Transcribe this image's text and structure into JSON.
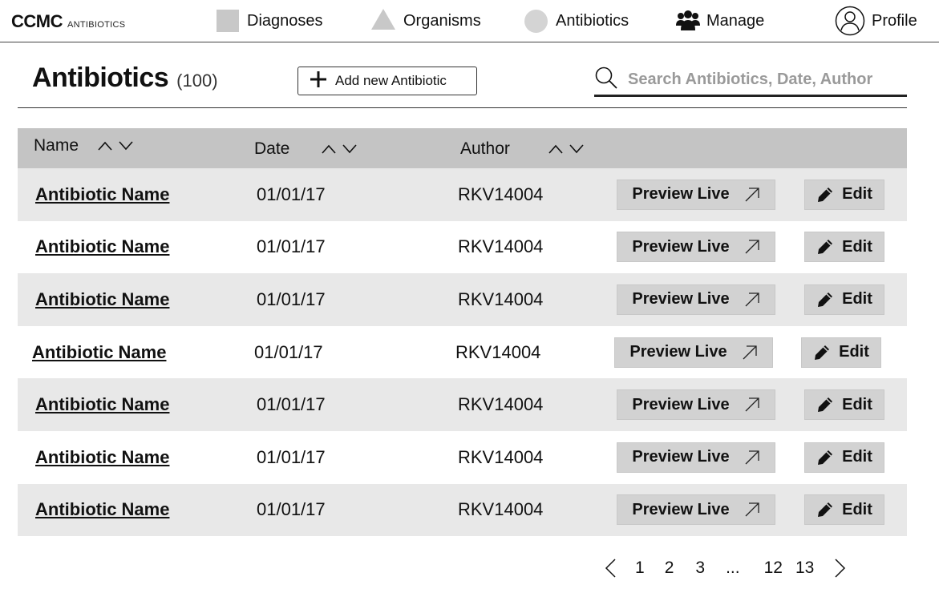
{
  "brand": {
    "main": "CCMC",
    "sub": "ANTIBIOTICS"
  },
  "nav": {
    "diagnoses": "Diagnoses",
    "organisms": "Organisms",
    "antibiotics": "Antibiotics",
    "manage": "Manage",
    "profile": "Profile",
    "icons": [
      "square-icon",
      "triangle-icon",
      "circle-icon",
      "users-icon",
      "user-circle-icon"
    ]
  },
  "header": {
    "title": "Antibiotics",
    "count": "(100)",
    "add_label": "Add new Antibiotic"
  },
  "search": {
    "placeholder": "Search Antibiotics, Date, Author",
    "value": ""
  },
  "table": {
    "columns": [
      "Name",
      "Date",
      "Author"
    ],
    "preview_label": "Preview Live",
    "edit_label": "Edit",
    "rows": [
      {
        "name": "Antibiotic Name",
        "date": "01/01/17",
        "author": "RKV14004"
      },
      {
        "name": "Antibiotic Name",
        "date": "01/01/17",
        "author": "RKV14004"
      },
      {
        "name": "Antibiotic Name",
        "date": "01/01/17",
        "author": "RKV14004"
      },
      {
        "name": "Antibiotic Name",
        "date": "01/01/17",
        "author": "RKV14004"
      },
      {
        "name": "Antibiotic Name",
        "date": "01/01/17",
        "author": "RKV14004"
      },
      {
        "name": "Antibiotic Name",
        "date": "01/01/17",
        "author": "RKV14004"
      },
      {
        "name": "Antibiotic Name",
        "date": "01/01/17",
        "author": "RKV14004"
      }
    ]
  },
  "pagination": {
    "pages": [
      "1",
      "2",
      "3",
      "...",
      "12",
      "13"
    ]
  },
  "colors": {
    "header_bg": "#c4c4c4",
    "row_shade": "#e8e8e8",
    "button_bg": "#d2d2d2",
    "nav_shape": "#c8c8c8"
  }
}
